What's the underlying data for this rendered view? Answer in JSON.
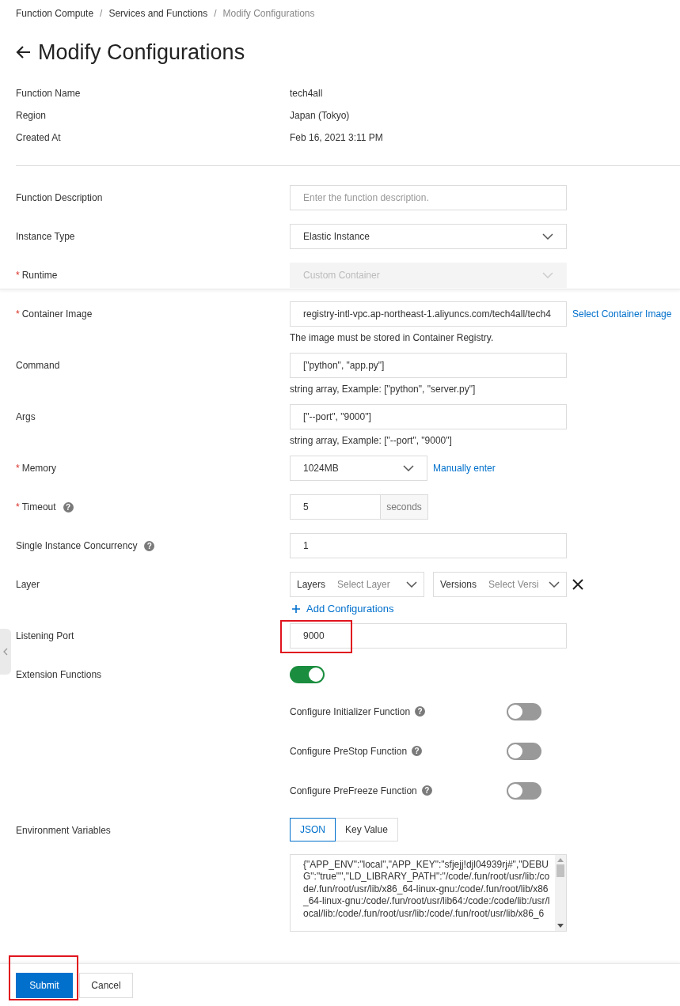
{
  "breadcrumb_separator": "/",
  "required_mark": "*",
  "help_mark": "?",
  "breadcrumb": [
    "Function Compute",
    "Services and Functions",
    "Modify Configurations"
  ],
  "title": "Modify Configurations",
  "info": [
    {
      "label": "Function Name",
      "value": "tech4all"
    },
    {
      "label": "Region",
      "value": "Japan (Tokyo)"
    },
    {
      "label": "Created At",
      "value": "Feb 16, 2021 3:11 PM"
    }
  ],
  "fields": [
    {
      "kind": "input",
      "label": "Function Description",
      "required": false,
      "help_icon": false,
      "placeholder": "Enter the function description."
    },
    {
      "kind": "select",
      "label": "Instance Type",
      "required": false,
      "help_icon": false,
      "value": "Elastic Instance",
      "disabled": false
    },
    {
      "kind": "select",
      "label": "Runtime",
      "required": true,
      "help_icon": false,
      "value": "Custom Container",
      "disabled": true
    },
    {
      "kind": "input",
      "label": "Container Image",
      "required": true,
      "help_icon": false,
      "value": "registry-intl-vpc.ap-northeast-1.aliyuncs.com/tech4all/tech4",
      "link": "Select Container Image",
      "help": "The image must be stored in Container Registry."
    },
    {
      "kind": "input",
      "label": "Command",
      "required": false,
      "help_icon": false,
      "value": "[\"python\", \"app.py\"]",
      "help": "string array, Example: [\"python\", \"server.py\"]"
    },
    {
      "kind": "input",
      "label": "Args",
      "required": false,
      "help_icon": false,
      "value": "[\"--port\", \"9000\"]",
      "help": "string array, Example: [\"--port\", \"9000\"]"
    },
    {
      "kind": "select",
      "label": "Memory",
      "required": true,
      "help_icon": false,
      "value": "1024MB",
      "disabled": false,
      "narrow": true,
      "link": "Manually enter"
    },
    {
      "kind": "addon",
      "label": "Timeout",
      "required": true,
      "help_icon": true,
      "value": "5",
      "addon": "seconds"
    },
    {
      "kind": "input",
      "label": "Single Instance Concurrency",
      "required": false,
      "help_icon": true,
      "value": "1"
    },
    {
      "kind": "layer",
      "label": "Layer",
      "required": false,
      "help_icon": false,
      "layer_label": "Layers",
      "layer_placeholder": "Select Layer",
      "version_label": "Versions",
      "version_placeholder": "Select Versi",
      "add": "Add Configurations"
    },
    {
      "kind": "input",
      "label": "Listening Port",
      "required": false,
      "help_icon": false,
      "value": "9000",
      "highlighted": true
    },
    {
      "kind": "toggle",
      "label": "Extension Functions",
      "required": false,
      "help_icon": false,
      "on": true
    },
    {
      "kind": "subtoggle",
      "label": "Configure Initializer Function",
      "required": false,
      "help_icon": true,
      "on": false
    },
    {
      "kind": "subtoggle",
      "label": "Configure PreStop Function",
      "required": false,
      "help_icon": true,
      "on": false
    },
    {
      "kind": "subtoggle",
      "label": "Configure PreFreeze Function",
      "required": false,
      "help_icon": true,
      "on": false
    },
    {
      "kind": "env",
      "label": "Environment Variables",
      "required": false,
      "help_icon": false,
      "tabs": [
        {
          "label": "JSON",
          "selected": true
        },
        {
          "label": "Key Value",
          "selected": false
        }
      ],
      "value": "{\"APP_ENV\":\"local\",\"APP_KEY\":\"sfjejj!djl04939rj#\",\"DEBUG\":\"true\"\",\"LD_LIBRARY_PATH\":\"/code/.fun/root/usr/lib:/code/.fun/root/usr/lib/x86_64-linux-gnu:/code/.fun/root/lib/x86_64-linux-gnu:/code/.fun/root/usr/lib64:/code:/code/lib:/usr/local/lib:/code/.fun/root/usr/lib:/code/.fun/root/usr/lib/x86_6"
    }
  ],
  "buttons": [
    {
      "label": "Submit",
      "kind": "primary",
      "highlighted": true
    },
    {
      "label": "Cancel",
      "kind": "secondary",
      "highlighted": false
    }
  ]
}
